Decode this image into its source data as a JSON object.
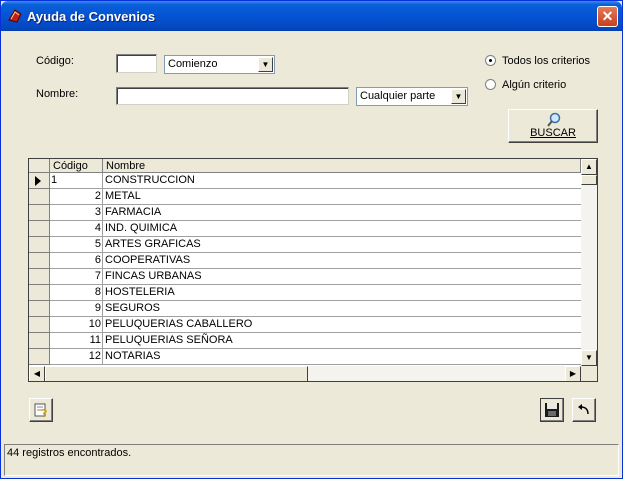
{
  "window": {
    "title": "Ayuda de Convenios",
    "close_label": "✕"
  },
  "form": {
    "codigo_label": "Código:",
    "codigo_value": "",
    "codigo_match": "Comienzo",
    "nombre_label": "Nombre:",
    "nombre_value": "",
    "nombre_match": "Cualquier parte",
    "criteria": [
      {
        "label": "Todos los criterios",
        "selected": true
      },
      {
        "label": "Algún criterio",
        "selected": false
      }
    ],
    "search_label": "BUSCAR"
  },
  "grid": {
    "columns": [
      "Código",
      "Nombre"
    ],
    "rows": [
      {
        "code": "1",
        "name": "CONSTRUCCION",
        "current": true
      },
      {
        "code": "2",
        "name": "METAL"
      },
      {
        "code": "3",
        "name": "FARMACIA"
      },
      {
        "code": "4",
        "name": "IND. QUIMICA"
      },
      {
        "code": "5",
        "name": "ARTES GRAFICAS"
      },
      {
        "code": "6",
        "name": "COOPERATIVAS"
      },
      {
        "code": "7",
        "name": "FINCAS URBANAS"
      },
      {
        "code": "8",
        "name": "HOSTELERIA"
      },
      {
        "code": "9",
        "name": "SEGUROS"
      },
      {
        "code": "10",
        "name": "PELUQUERIAS CABALLERO"
      },
      {
        "code": "11",
        "name": "PELUQUERIAS SEÑORA"
      },
      {
        "code": "12",
        "name": "NOTARIAS"
      }
    ]
  },
  "status": {
    "text": "44 registros encontrados."
  }
}
